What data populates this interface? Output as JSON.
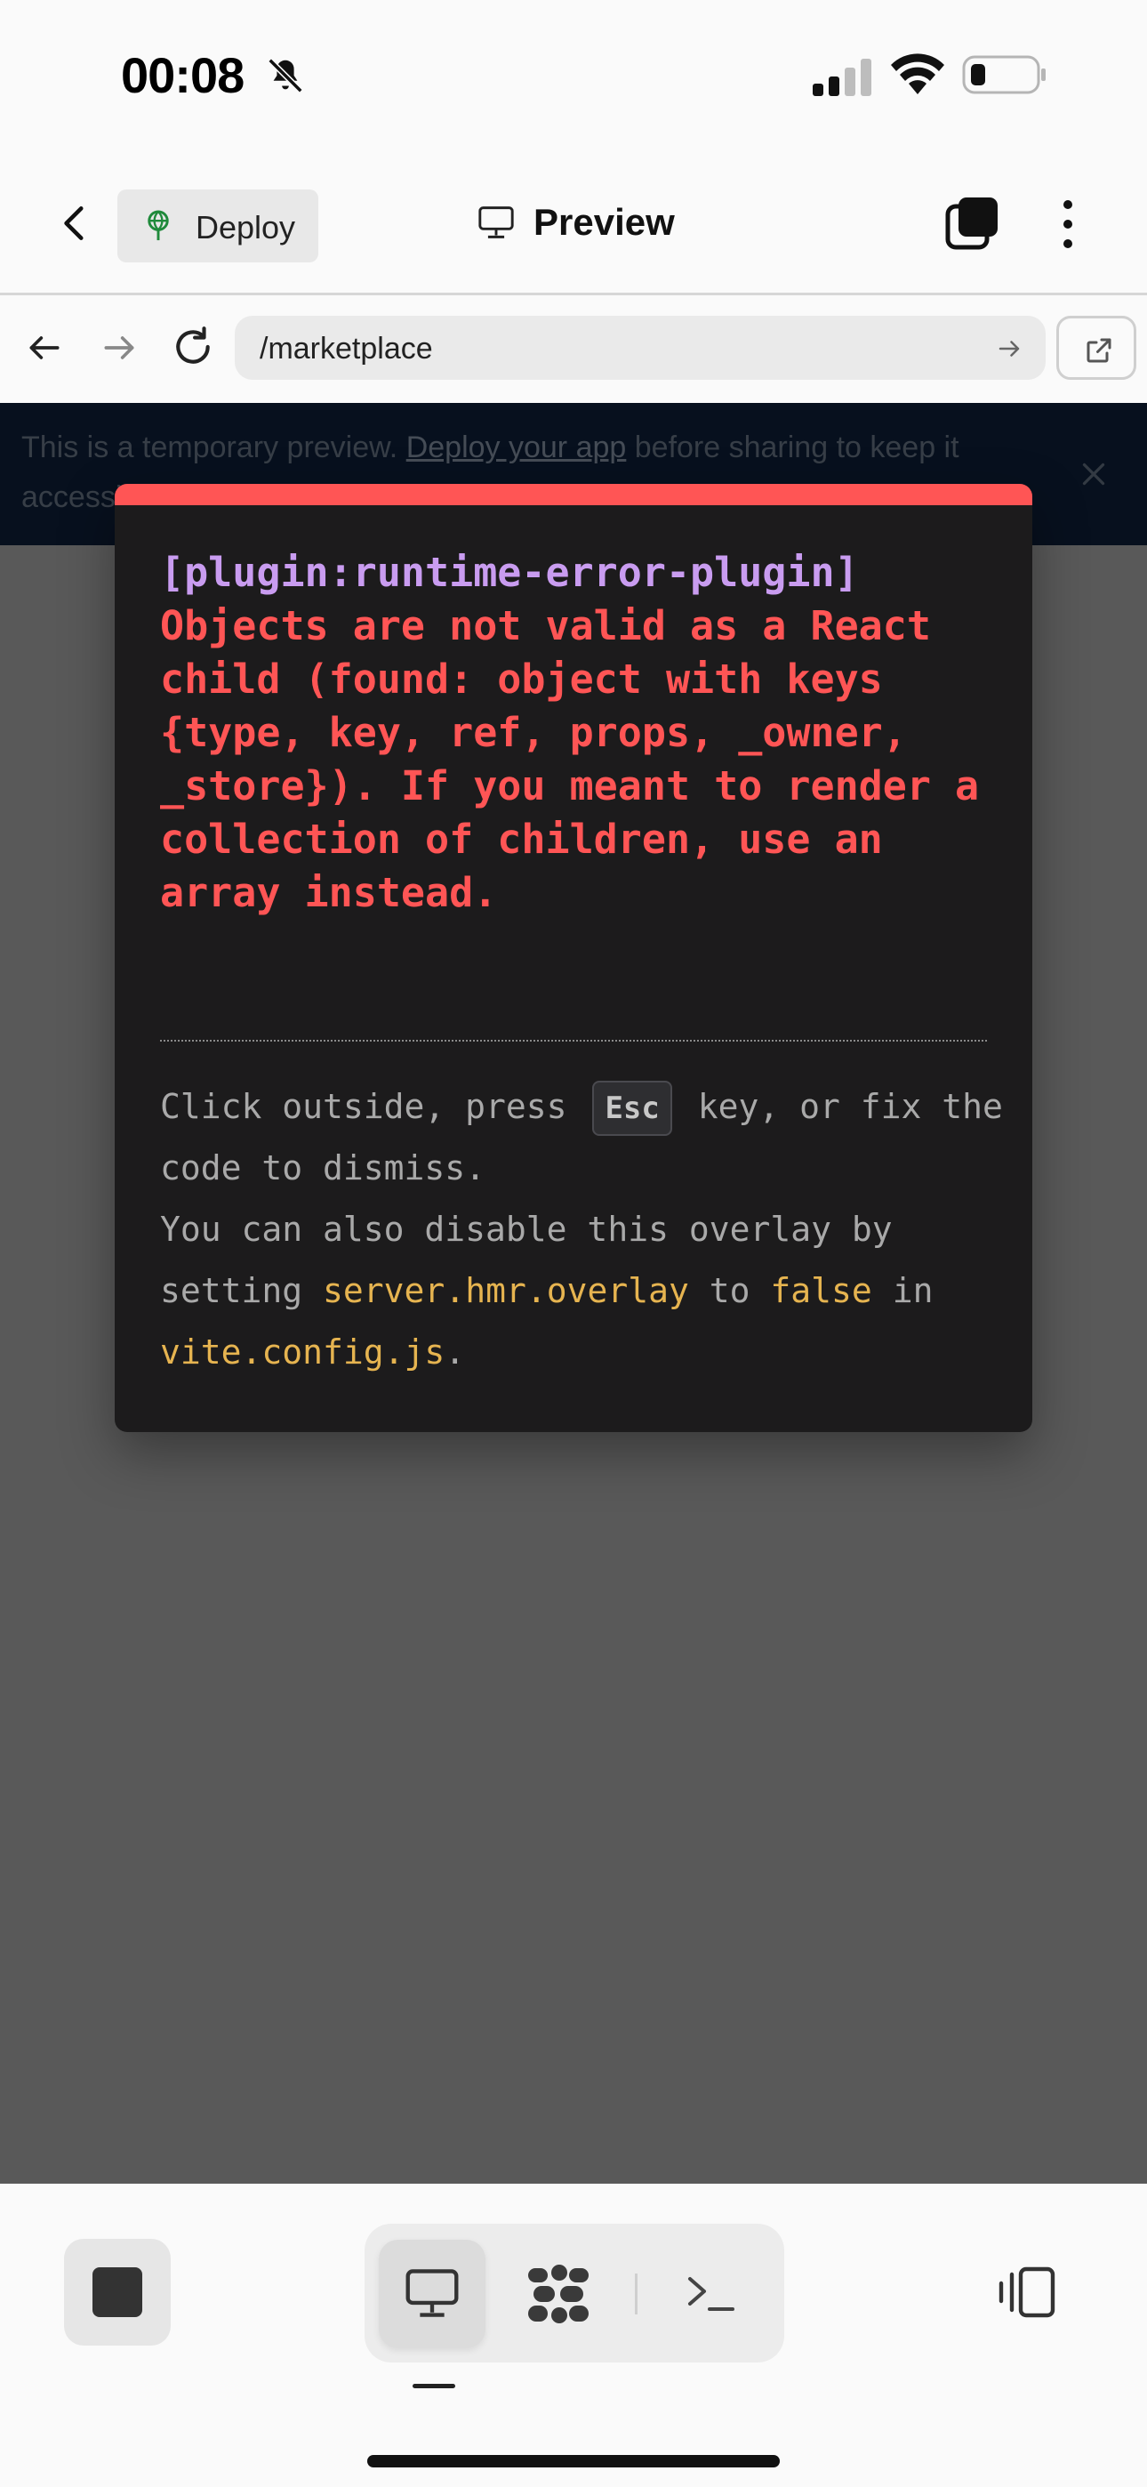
{
  "status_bar": {
    "time": "00:08",
    "icons": [
      "bell-slash-icon",
      "cellular-signal-icon",
      "wifi-icon",
      "battery-icon"
    ]
  },
  "header": {
    "deploy_label": "Deploy",
    "title": "Preview"
  },
  "browser": {
    "url": "/marketplace"
  },
  "banner": {
    "text_before": "This is a temporary preview. ",
    "link": "Deploy your app",
    "text_after": " before sharing to keep it accessible."
  },
  "error_overlay": {
    "plugin": "[plugin:runtime-error-plugin]",
    "message": "Objects are not valid as a React child (found: object with keys {type, key, ref, props, _owner, _store}). If you meant to render a collection of children, use an array instead.",
    "tip_1": "Click outside, press",
    "tip_key": "Esc",
    "tip_2": "key, or fix the code to dismiss.",
    "tip_3": "You can also disable this overlay by setting",
    "tip_code_1": "server.hmr.overlay",
    "tip_4": "to",
    "tip_code_2": "false",
    "tip_5": "in",
    "tip_code_3": "vite.config.js",
    "tip_6": "."
  },
  "colors": {
    "accent_red": "#ff5555",
    "plugin_purple": "#c99cf0",
    "code_yellow": "#e6b450",
    "banner_bg": "#0b1a2e"
  }
}
